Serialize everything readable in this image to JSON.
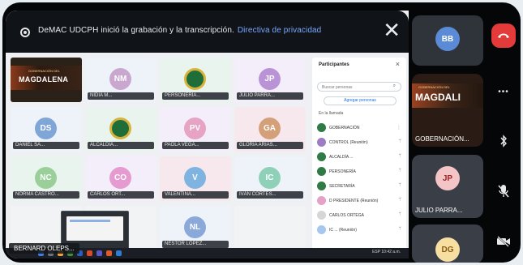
{
  "banner": {
    "message": "DeMAC UDCPH inició la grabación y la transcripción.",
    "link": "Directiva de privacidad"
  },
  "grid": {
    "tiles": [
      {
        "initials": "",
        "name": "",
        "kind": "video",
        "video_title": "MAGDALENA",
        "video_sub": "GOBERNACIÓN DEL"
      },
      {
        "initials": "NM",
        "name": "NIDIA M...",
        "kind": "avatar",
        "color": "#c9a7cf"
      },
      {
        "initials": "",
        "name": "PERSONERÍA...",
        "kind": "logo"
      },
      {
        "initials": "JP",
        "name": "JULIO PARRA...",
        "kind": "avatar",
        "color": "#b993d6"
      },
      {
        "initials": "DS",
        "name": "DANIEL SA...",
        "kind": "avatar",
        "color": "#7fa6d6"
      },
      {
        "initials": "",
        "name": "ALCALDÍA...",
        "kind": "logo"
      },
      {
        "initials": "PV",
        "name": "PAOLA VEGA...",
        "kind": "avatar",
        "color": "#e6a3c4"
      },
      {
        "initials": "GA",
        "name": "GLORIA ARIAS...",
        "kind": "avatar",
        "color": "#d4a07a"
      },
      {
        "initials": "NC",
        "name": "NORMA CASTRO...",
        "kind": "avatar",
        "color": "#9bcf9a"
      },
      {
        "initials": "CO",
        "name": "CARLOS ORT...",
        "kind": "avatar",
        "color": "#e59bcf"
      },
      {
        "initials": "V",
        "name": "VALENTINA...",
        "kind": "avatar",
        "color": "#7fb3e0"
      },
      {
        "initials": "IC",
        "name": "IVÁN CORTÉS...",
        "kind": "avatar",
        "color": "#8fd0b8"
      },
      {
        "initials": "",
        "name": "",
        "kind": "empty"
      },
      {
        "initials": "",
        "name": "",
        "kind": "empty"
      },
      {
        "initials": "NL",
        "name": "NÉSTOR LÓPEZ...",
        "kind": "avatar",
        "color": "#8aa9d9"
      },
      {
        "initials": "",
        "name": "",
        "kind": "empty"
      }
    ]
  },
  "participants_panel": {
    "title": "Participantes",
    "close": "×",
    "search_placeholder": "Buscar personas",
    "add_button": "Agregar personas",
    "section": "En la llamada",
    "people": [
      {
        "name": "GOBERNACIÓN",
        "color": "#2f7a45",
        "mic": "⋮"
      },
      {
        "name": "CONTROL (Reunión)",
        "color": "#9d7cc4",
        "mic": "ᛘ"
      },
      {
        "name": "ALCALDÍA ...",
        "color": "#2f7a45",
        "mic": "ᛘ"
      },
      {
        "name": "PERSONERÍA",
        "color": "#2f7a45",
        "mic": "ᛘ"
      },
      {
        "name": "SECRETARÍA",
        "color": "#2f7a45",
        "mic": "ᛘ"
      },
      {
        "name": "D PRESIDENTE (Reunión)",
        "color": "#e7a0c8",
        "mic": "ᛘ"
      },
      {
        "name": "CARLOS ORTEGA",
        "color": "#d6d6d6",
        "mic": "ᛘ"
      },
      {
        "name": "IC ... (Reunión)",
        "color": "#a6c8ef",
        "mic": "ᛘ"
      }
    ]
  },
  "share_label": "BERNARD OLEPS...",
  "taskbar": {
    "tray": "ESP  10:42  a.m."
  },
  "strip": {
    "tiles": [
      {
        "initials": "BB",
        "label": "",
        "color": "#5b8ad6",
        "text": "#ffffff"
      },
      {
        "video_title": "MAGDALI",
        "video_sub": "GOBERNACIÓN DEL",
        "label": "GOBERNACIÓN...",
        "kind": "video"
      },
      {
        "initials": "JP",
        "label": "JULIO PARRA...",
        "color": "#f4c5c7",
        "text": "#9b2424"
      },
      {
        "initials": "DG",
        "label": "",
        "color": "#f6dfa0",
        "text": "#8a5a14"
      }
    ]
  },
  "controls": {
    "items": [
      {
        "name": "end-call",
        "glyph": "☎"
      },
      {
        "name": "more",
        "glyph": "•••"
      },
      {
        "name": "bluetooth",
        "glyph": "✱"
      },
      {
        "name": "mic-off",
        "glyph": "🎙"
      },
      {
        "name": "camera-off",
        "glyph": "▶"
      }
    ]
  }
}
